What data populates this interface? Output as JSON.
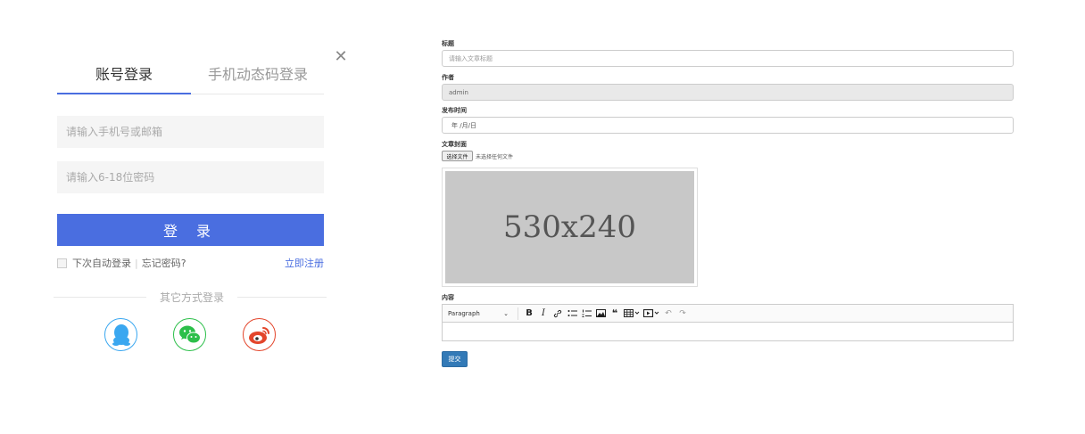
{
  "login": {
    "tabs": [
      {
        "label": "账号登录",
        "active": true
      },
      {
        "label": "手机动态码登录",
        "active": false
      }
    ],
    "close_glyph": "✕",
    "username_placeholder": "请输入手机号或邮箱",
    "password_placeholder": "请输入6-18位密码",
    "submit_label": "登 录",
    "remember_label": "下次自动登录",
    "forgot_label": "忘记密码?",
    "register_label": "立即注册",
    "other_methods_label": "其它方式登录",
    "social": [
      "qq-icon",
      "wechat-icon",
      "weibo-icon"
    ],
    "accent_color": "#4a6ee0"
  },
  "form": {
    "title_label": "标题",
    "title_placeholder": "请输入文章标题",
    "author_label": "作者",
    "author_value": "admin",
    "date_label": "发布时间",
    "date_value": "年 /月/日",
    "cover_label": "文章封面",
    "file_button_label": "选择文件",
    "file_status": "未选择任何文件",
    "cover_placeholder_text": "530x240",
    "content_label": "内容",
    "editor": {
      "format_select": "Paragraph",
      "buttons": [
        "bold-icon",
        "italic-icon",
        "link-icon",
        "bulleted-list-icon",
        "numbered-list-icon",
        "image-icon",
        "blockquote-icon",
        "table-icon",
        "media-icon",
        "undo-icon",
        "redo-icon"
      ]
    },
    "submit_label": "提交",
    "submit_color": "#337ab7"
  }
}
